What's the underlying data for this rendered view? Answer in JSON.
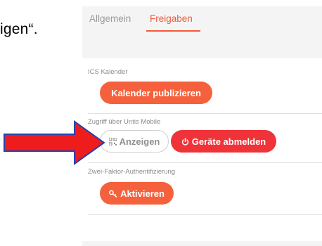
{
  "doc_fragment": "igen“.",
  "tabs": [
    {
      "label": "Allgemein",
      "active": false
    },
    {
      "label": "Freigaben",
      "active": true
    }
  ],
  "sections": {
    "ics": {
      "label": "ICS Kalender",
      "button": "Kalender publizieren"
    },
    "untis_mobile": {
      "label": "Zugriff über Untis Mobile",
      "show_button": "Anzeigen",
      "show_icon": "qr-code-icon",
      "logout_button": "Geräte abmelden",
      "logout_icon": "power-icon"
    },
    "two_factor": {
      "label": "Zwei-Faktor-Authentifizierung",
      "button": "Aktivieren",
      "button_icon": "key-icon"
    }
  },
  "annotation": {
    "arrow_color": "#ee1c1c",
    "arrow_border": "#2b3fa8"
  },
  "colors": {
    "accent": "#f05a3a",
    "button_orange": "#f4613c",
    "button_red": "#ef3338"
  }
}
